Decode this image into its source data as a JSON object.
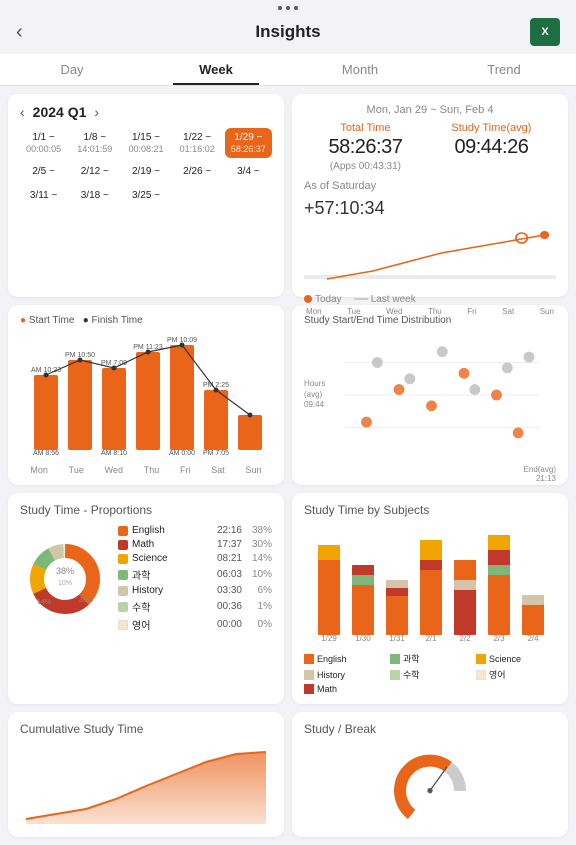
{
  "statusBar": {
    "dots": 3
  },
  "header": {
    "title": "Insights",
    "backIcon": "‹",
    "excelLabel": "X"
  },
  "tabs": [
    {
      "id": "day",
      "label": "Day",
      "active": false
    },
    {
      "id": "week",
      "label": "Week",
      "active": true
    },
    {
      "id": "month",
      "label": "Month",
      "active": false
    },
    {
      "id": "trend",
      "label": "Trend",
      "active": false
    }
  ],
  "weekSelector": {
    "period": "2024 Q1",
    "weeks": [
      {
        "range": "1/1 ~",
        "time": "00:00:05",
        "selected": false
      },
      {
        "range": "1/8 ~",
        "time": "14:01:59",
        "selected": false
      },
      {
        "range": "1/15 ~",
        "time": "00:08:21",
        "selected": false
      },
      {
        "range": "1/22 ~",
        "time": "01:16:02",
        "selected": false
      },
      {
        "range": "1/29 ~",
        "time": "58:26:37",
        "selected": true
      },
      {
        "range": "2/5 ~",
        "time": "",
        "selected": false
      },
      {
        "range": "2/12 ~",
        "time": "",
        "selected": false
      },
      {
        "range": "2/19 ~",
        "time": "",
        "selected": false
      },
      {
        "range": "2/26 ~",
        "time": "",
        "selected": false
      },
      {
        "range": "3/4 ~",
        "time": "",
        "selected": false
      },
      {
        "range": "3/11 ~",
        "time": "",
        "selected": false
      },
      {
        "range": "3/18 ~",
        "time": "",
        "selected": false
      },
      {
        "range": "3/25 ~",
        "time": "",
        "selected": false
      }
    ]
  },
  "statsCard": {
    "dateRange": "Mon, Jan 29 ~ Sun, Feb 4",
    "totalTimeLabel": "Total Time",
    "avgTimeLabel": "Study Time(avg)",
    "totalTime": "58:26:37",
    "avgTime": "09:44:26",
    "appsTime": "(Apps 00:43:31)",
    "asOfLabel": "As of Saturday",
    "delta": "+57:10:34",
    "todayLabel": "Today",
    "lastWeekLabel": "Last week",
    "xLabels": [
      "Mon",
      "Tue",
      "Wed",
      "Thu",
      "Fri",
      "Sat",
      "Sun"
    ]
  },
  "startEndChart": {
    "title": "● Start Time  ● Finish Time",
    "bars": [
      {
        "day": "Mon",
        "startLabel": "AM 10:23",
        "endLabel": "",
        "barH": 0.7
      },
      {
        "day": "Tue",
        "startLabel": "AM 8:56",
        "endLabel": "PM 10:50",
        "barH": 0.85
      },
      {
        "day": "Wed",
        "startLabel": "AM 8:10",
        "endLabel": "PM 7:09",
        "barH": 0.75
      },
      {
        "day": "Thu",
        "startLabel": "",
        "endLabel": "PM 11:23",
        "barH": 0.9
      },
      {
        "day": "Fri",
        "startLabel": "AM 0:00",
        "endLabel": "PM 10:09",
        "barH": 0.95
      },
      {
        "day": "Sat",
        "startLabel": "PM 2:25",
        "endLabel": "",
        "barH": 0.55
      },
      {
        "day": "Sun",
        "startLabel": "PM 7:05",
        "endLabel": "",
        "barH": 0.3
      }
    ]
  },
  "distributionChart": {
    "title": "Study Start/End Time Distribution",
    "yLabel": "Hours\n(avg)\n09:44",
    "xLabel": "End(avg)\n21:13"
  },
  "proportions": {
    "title": "Study Time - Proportions",
    "subjects": [
      {
        "name": "English",
        "time": "22:16",
        "pct": "38%",
        "color": "#E8651A",
        "slice": 38
      },
      {
        "name": "Math",
        "time": "17:37",
        "pct": "30%",
        "color": "#C0392B",
        "slice": 30
      },
      {
        "name": "Science",
        "time": "08:21",
        "pct": "14%",
        "color": "#F0A500",
        "slice": 14
      },
      {
        "name": "과학",
        "time": "06:03",
        "pct": "10%",
        "color": "#7DB87A",
        "slice": 10
      },
      {
        "name": "History",
        "time": "03:30",
        "pct": "6%",
        "color": "#D4C5A9",
        "slice": 6
      },
      {
        "name": "수학",
        "time": "00:36",
        "pct": "1%",
        "color": "#B8D4A8",
        "slice": 1
      },
      {
        "name": "영어",
        "time": "00:00",
        "pct": "0%",
        "color": "#F5E6D0",
        "slice": 1
      }
    ]
  },
  "subjectsByDay": {
    "title": "Study Time by Subjects",
    "days": [
      "1/29",
      "1/30",
      "1/31",
      "2/1",
      "2/2",
      "2/3",
      "2/4"
    ],
    "legend": [
      {
        "name": "English",
        "color": "#E8651A"
      },
      {
        "name": "과학",
        "color": "#7DB87A"
      },
      {
        "name": "Science",
        "color": "#F0A500"
      },
      {
        "name": "History",
        "color": "#D4C5A9"
      },
      {
        "name": "수학",
        "color": "#B8D4A8"
      },
      {
        "name": "영어",
        "color": "#F5E6D0"
      },
      {
        "name": "Math",
        "color": "#C0392B"
      }
    ]
  },
  "cumulative": {
    "title": "Cumulative Study Time"
  },
  "studyBreak": {
    "title": "Study / Break"
  }
}
